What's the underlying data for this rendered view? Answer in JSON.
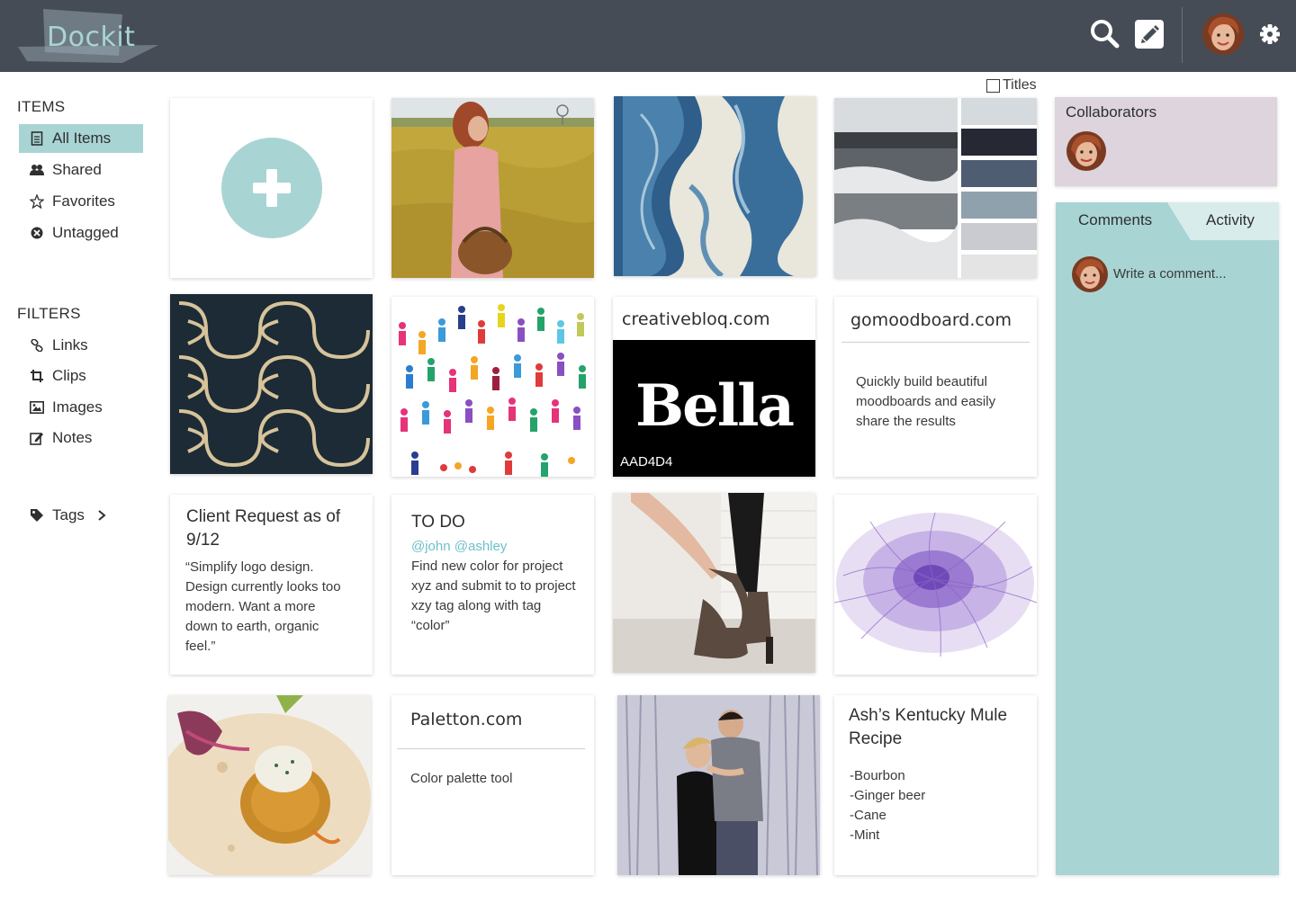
{
  "app": {
    "name": "Dockit",
    "colors": {
      "header": "#454c55",
      "accent": "#a9d4d4",
      "collaborators_bg": "#ddd4dd"
    }
  },
  "header": {
    "icons": [
      "search-icon",
      "edit-icon",
      "user-avatar",
      "gear-icon"
    ]
  },
  "sidebar": {
    "items_heading": "ITEMS",
    "items": [
      {
        "label": "All Items",
        "icon": "document-icon",
        "active": true
      },
      {
        "label": "Shared",
        "icon": "users-icon"
      },
      {
        "label": "Favorites",
        "icon": "star-icon"
      },
      {
        "label": "Untagged",
        "icon": "untagged-icon"
      }
    ],
    "filters_heading": "FILTERS",
    "filters": [
      {
        "label": "Links",
        "icon": "link-icon"
      },
      {
        "label": "Clips",
        "icon": "crop-icon"
      },
      {
        "label": "Images",
        "icon": "image-icon"
      },
      {
        "label": "Notes",
        "icon": "note-icon"
      }
    ],
    "tags_label": "Tags"
  },
  "toolbar": {
    "titles_label": "Titles",
    "titles_checked": false
  },
  "cards": {
    "creativebloq": {
      "title": "creativebloq.com",
      "clip_text": "Bella",
      "clip_color_label": "AAD4D4"
    },
    "gomoodboard": {
      "title": "gomoodboard.com",
      "description": "Quickly build beautiful moodboards and easily share the results"
    },
    "client_request": {
      "title": "Client Request as of 9/12",
      "body": "“Simplify logo design. Design currently looks too modern. Want a more down to earth, organic feel.”"
    },
    "todo": {
      "title": "TO DO",
      "mentions": "@john @ashley",
      "body": "Find new color for project xyz and submit to to project xzy tag along with tag “color”"
    },
    "paletton": {
      "title": "Paletton.com",
      "description": "Color palette tool"
    },
    "recipe": {
      "title": "Ash’s Kentucky Mule Recipe",
      "lines": [
        "-Bourbon",
        "-Ginger beer",
        "-Cane",
        "-Mint"
      ]
    },
    "palette_swatches": [
      "#d4dade",
      "#262834",
      "#4e5d71",
      "#8fa1ad",
      "#c9cbd0",
      "#e4e4e4"
    ]
  },
  "panel": {
    "collaborators_title": "Collaborators",
    "tabs": [
      "Comments",
      "Activity"
    ],
    "comment_placeholder": "Write a comment..."
  }
}
